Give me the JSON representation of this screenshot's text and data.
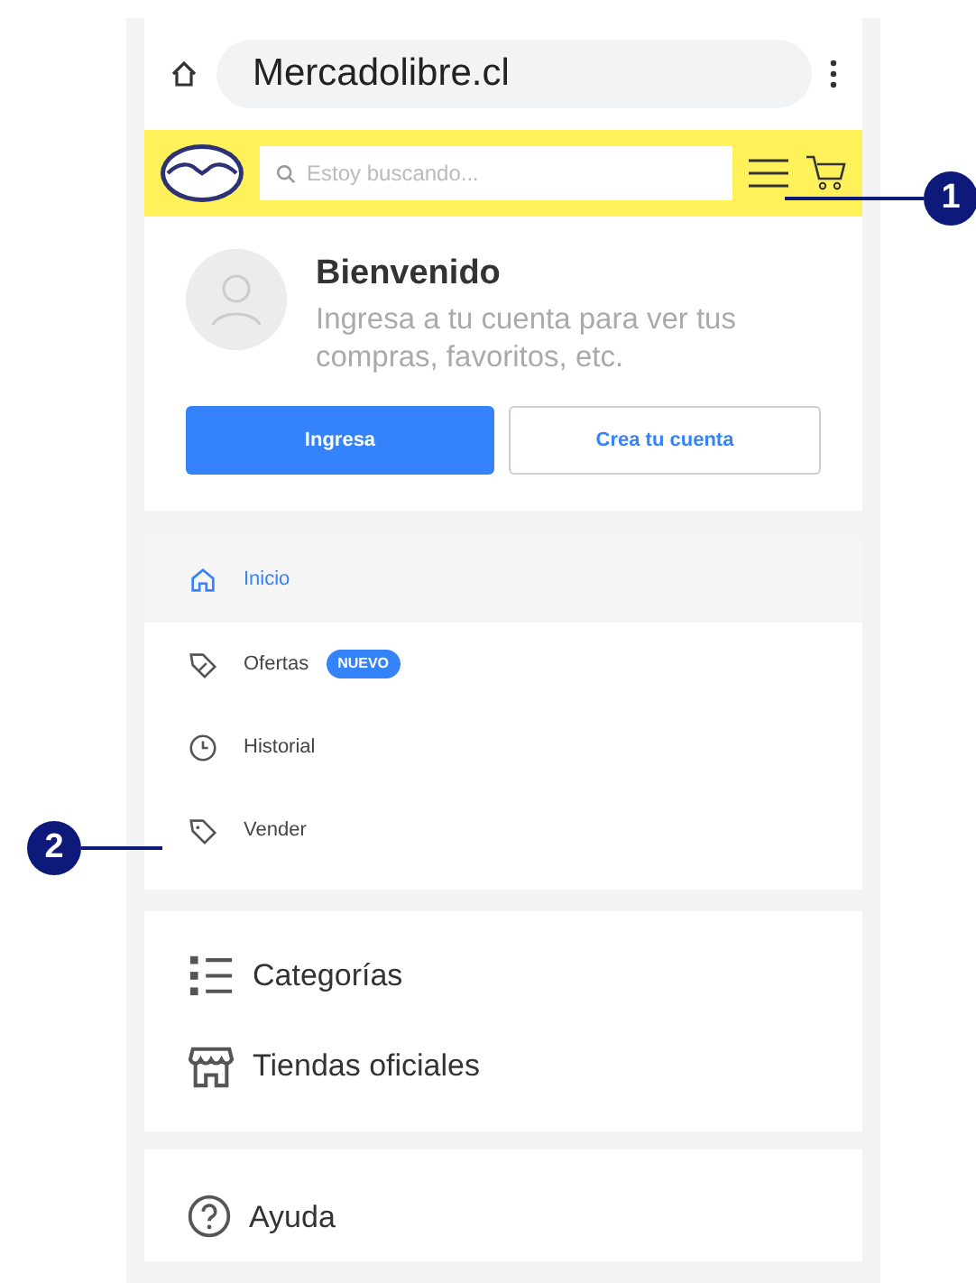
{
  "browser": {
    "url": "Mercadolibre.cl"
  },
  "header": {
    "search": {
      "placeholder": "Estoy buscando..."
    }
  },
  "welcome": {
    "title": "Bienvenido",
    "subtitle": "Ingresa a tu cuenta para ver tus compras, favoritos, etc."
  },
  "buttons": [
    {
      "label": "Ingresa",
      "kind": "primary"
    },
    {
      "label": "Crea tu cuenta",
      "kind": "outline"
    }
  ],
  "menu": [
    {
      "label": "Inicio",
      "kind": "home",
      "selected": true
    },
    {
      "label": "Ofertas",
      "kind": "offer",
      "selected": false,
      "badge": "NUEVO"
    },
    {
      "label": "Historial",
      "kind": "clock",
      "selected": false
    },
    {
      "label": "Vender",
      "kind": "tag",
      "selected": false
    }
  ],
  "sections": [
    {
      "label": "Categorías",
      "kind": "list"
    },
    {
      "label": "Tiendas oficiales",
      "kind": "store"
    }
  ],
  "help": {
    "label": "Ayuda"
  },
  "callouts": [
    {
      "label": "1"
    },
    {
      "label": "2"
    }
  ]
}
